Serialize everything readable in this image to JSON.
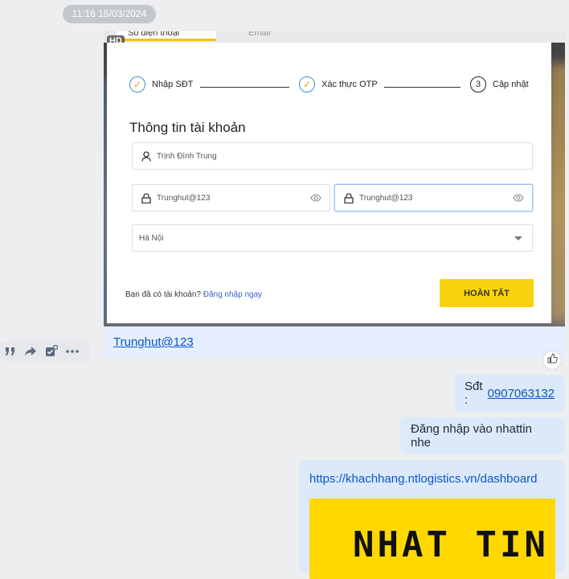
{
  "timestamp": "11:16 15/03/2024",
  "screenshot": {
    "badge": "HD",
    "tabs": [
      "Số điện thoại",
      "Email"
    ],
    "steps": [
      {
        "label": "Nhập SĐT",
        "state": "done"
      },
      {
        "label": "Xác thực OTP",
        "state": "done"
      },
      {
        "label": "Cập nhật",
        "number": "3",
        "state": "current"
      }
    ],
    "title": "Thông tin tài khoản",
    "fields": {
      "name": "Trịnh Đình Trung",
      "password": "Trunghut@123",
      "confirm_password": "Trunghut@123",
      "city": "Hà Nội"
    },
    "have_account": "Bạn đã có tài khoản?",
    "login_link": "Đăng nhập ngay",
    "done_button": "HOÀN TẤT"
  },
  "caption_link": "Trunghut@123",
  "messages": {
    "phone_label": "Sđt :",
    "phone_value": "0907063132",
    "login_note": "Đăng nhập vào nhattin nhe",
    "url": "https://khachhang.ntlogistics.vn/dashboard",
    "preview_logo": "NHAT TIN"
  },
  "icons": {
    "actions": [
      "quote-icon",
      "forward-icon",
      "task-icon",
      "more-icon"
    ],
    "reaction": "thumbs-up-icon"
  },
  "colors": {
    "accent_yellow": "#f8d20a",
    "bubble": "#dce9fb",
    "link": "#0a56c7"
  }
}
